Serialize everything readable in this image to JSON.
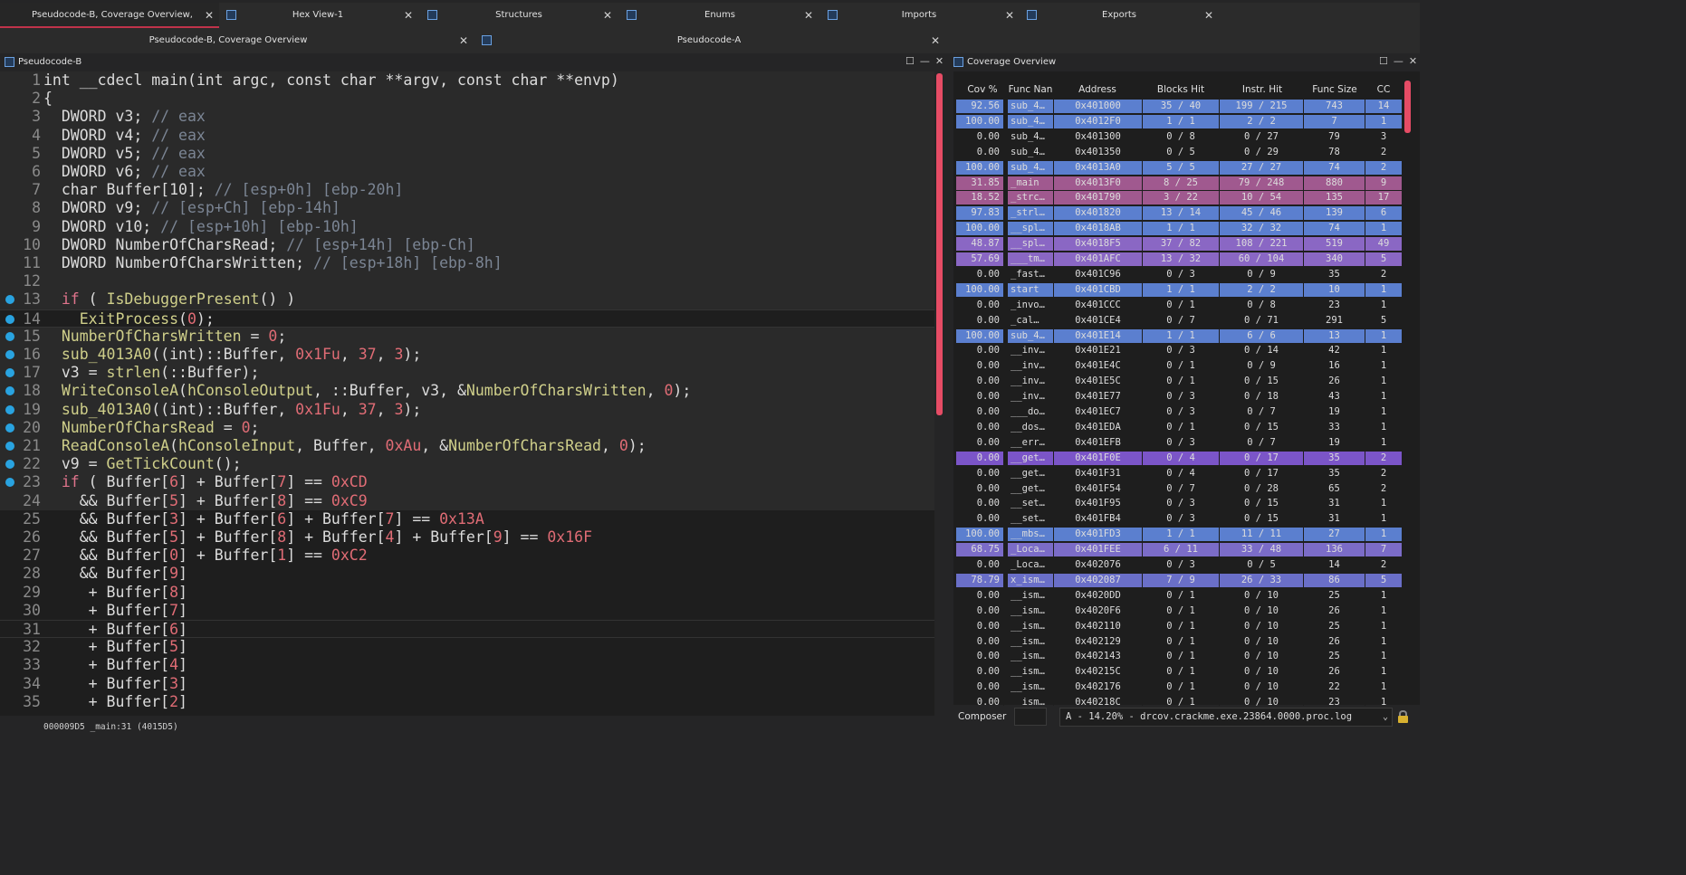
{
  "tabs_row1": [
    {
      "label": "Pseudocode-B, Coverage Overview, Pseudocode-A",
      "active": true
    },
    {
      "label": "Hex View-1",
      "active": false
    },
    {
      "label": "Structures",
      "active": false
    },
    {
      "label": "Enums",
      "active": false
    },
    {
      "label": "Imports",
      "active": false
    },
    {
      "label": "Exports",
      "active": false
    }
  ],
  "tabs_row2": [
    {
      "label": "Pseudocode-B, Coverage Overview"
    },
    {
      "label": "Pseudocode-A"
    }
  ],
  "close_glyph": "✕",
  "pseudocode_panel": {
    "title": "Pseudocode-B"
  },
  "coverage_panel": {
    "title": "Coverage Overview"
  },
  "code_lines": [
    {
      "n": "1",
      "bp": false,
      "hl": true,
      "html": "int __cdecl main(int argc, const char **argv, const char **envp)"
    },
    {
      "n": "2",
      "bp": false,
      "hl": true,
      "html": "{"
    },
    {
      "n": "3",
      "bp": false,
      "hl": true,
      "html": "  DWORD v3; <span class='cm'>// eax</span>"
    },
    {
      "n": "4",
      "bp": false,
      "hl": true,
      "html": "  DWORD v4; <span class='cm'>// eax</span>"
    },
    {
      "n": "5",
      "bp": false,
      "hl": true,
      "html": "  DWORD v5; <span class='cm'>// eax</span>"
    },
    {
      "n": "6",
      "bp": false,
      "hl": true,
      "html": "  DWORD v6; <span class='cm'>// eax</span>"
    },
    {
      "n": "7",
      "bp": false,
      "hl": true,
      "html": "  char Buffer[10]; <span class='cm'>// [esp+0h] [ebp-20h]</span>"
    },
    {
      "n": "8",
      "bp": false,
      "hl": true,
      "html": "  DWORD v9; <span class='cm'>// [esp+Ch] [ebp-14h]</span>"
    },
    {
      "n": "9",
      "bp": false,
      "hl": true,
      "html": "  DWORD v10; <span class='cm'>// [esp+10h] [ebp-10h]</span>"
    },
    {
      "n": "10",
      "bp": false,
      "hl": true,
      "html": "  DWORD NumberOfCharsRead; <span class='cm'>// [esp+14h] [ebp-Ch]</span>"
    },
    {
      "n": "11",
      "bp": false,
      "hl": true,
      "html": "  DWORD NumberOfCharsWritten; <span class='cm'>// [esp+18h] [ebp-8h]</span>"
    },
    {
      "n": "12",
      "bp": false,
      "hl": true,
      "html": ""
    },
    {
      "n": "13",
      "bp": true,
      "hl": true,
      "html": "  <span class='kw'>if</span> ( <span class='fn'>IsDebuggerPresent</span>() )"
    },
    {
      "n": "14",
      "bp": true,
      "hl": false,
      "cur": true,
      "html": "    <span class='fn'>ExitProcess</span>(<span class='num'>0</span>);"
    },
    {
      "n": "15",
      "bp": true,
      "hl": true,
      "html": "  <span class='fn'>NumberOfCharsWritten</span> = <span class='num'>0</span>;"
    },
    {
      "n": "16",
      "bp": true,
      "hl": true,
      "html": "  <span class='fn'>sub_4013A0</span>((int)::Buffer, <span class='num'>0x1Fu</span>, <span class='num'>37</span>, <span class='num'>3</span>);"
    },
    {
      "n": "17",
      "bp": true,
      "hl": true,
      "html": "  v3 = <span class='fn'>strlen</span>(::Buffer);"
    },
    {
      "n": "18",
      "bp": true,
      "hl": true,
      "html": "  <span class='fn'>WriteConsoleA</span>(<span class='fn'>hConsoleOutput</span>, ::Buffer, v3, &amp;<span class='fn'>NumberOfCharsWritten</span>, <span class='num'>0</span>);"
    },
    {
      "n": "19",
      "bp": true,
      "hl": true,
      "html": "  <span class='fn'>sub_4013A0</span>((int)::Buffer, <span class='num'>0x1Fu</span>, <span class='num'>37</span>, <span class='num'>3</span>);"
    },
    {
      "n": "20",
      "bp": true,
      "hl": true,
      "html": "  <span class='fn'>NumberOfCharsRead</span> = <span class='num'>0</span>;"
    },
    {
      "n": "21",
      "bp": true,
      "hl": true,
      "html": "  <span class='fn'>ReadConsoleA</span>(<span class='fn'>hConsoleInput</span>, Buffer, <span class='num'>0xAu</span>, &amp;<span class='fn'>NumberOfCharsRead</span>, <span class='num'>0</span>);"
    },
    {
      "n": "22",
      "bp": true,
      "hl": true,
      "html": "  v9 = <span class='fn'>GetTickCount</span>();"
    },
    {
      "n": "23",
      "bp": true,
      "hl": true,
      "html": "  <span class='kw'>if</span> ( Buffer[<span class='num'>6</span>] + Buffer[<span class='num'>7</span>] == <span class='num'>0xCD</span>"
    },
    {
      "n": "24",
      "bp": false,
      "hl": true,
      "html": "    &amp;&amp; Buffer[<span class='num'>5</span>] + Buffer[<span class='num'>8</span>] == <span class='num'>0xC9</span>"
    },
    {
      "n": "25",
      "bp": false,
      "hl": false,
      "html": "    &amp;&amp; Buffer[<span class='num'>3</span>] + Buffer[<span class='num'>6</span>] + Buffer[<span class='num'>7</span>] == <span class='num'>0x13A</span>"
    },
    {
      "n": "26",
      "bp": false,
      "hl": false,
      "html": "    &amp;&amp; Buffer[<span class='num'>5</span>] + Buffer[<span class='num'>8</span>] + Buffer[<span class='num'>4</span>] + Buffer[<span class='num'>9</span>] == <span class='num'>0x16F</span>"
    },
    {
      "n": "27",
      "bp": false,
      "hl": false,
      "html": "    &amp;&amp; Buffer[<span class='num'>0</span>] + Buffer[<span class='num'>1</span>] == <span class='num'>0xC2</span>"
    },
    {
      "n": "28",
      "bp": false,
      "hl": false,
      "html": "    &amp;&amp; Buffer[<span class='num'>9</span>]"
    },
    {
      "n": "29",
      "bp": false,
      "hl": false,
      "html": "     + Buffer[<span class='num'>8</span>]"
    },
    {
      "n": "30",
      "bp": false,
      "hl": false,
      "html": "     + Buffer[<span class='num'>7</span>]"
    },
    {
      "n": "31",
      "bp": false,
      "hl": false,
      "cur": true,
      "html": "     + Buffer[<span class='num'>6</span>]"
    },
    {
      "n": "32",
      "bp": false,
      "hl": false,
      "html": "     + Buffer[<span class='num'>5</span>]"
    },
    {
      "n": "33",
      "bp": false,
      "hl": false,
      "html": "     + Buffer[<span class='num'>4</span>]"
    },
    {
      "n": "34",
      "bp": false,
      "hl": false,
      "html": "     + Buffer[<span class='num'>3</span>]"
    },
    {
      "n": "35",
      "bp": false,
      "hl": false,
      "html": "     + Buffer[<span class='num'>2</span>]"
    }
  ],
  "status_line": "000009D5 _main:31 (4015D5)",
  "coverage": {
    "columns": [
      "Cov %",
      "Func Nan",
      "Address",
      "Blocks Hit",
      "Instr. Hit",
      "Func Size",
      "CC"
    ],
    "rows": [
      {
        "cov": "92.56",
        "name": "sub_4…",
        "addr": "0x401000",
        "blocks": "35 / 40",
        "instr": "199 / 215",
        "size": "743",
        "cc": "14",
        "bg": "#5b7fcf"
      },
      {
        "cov": "100.00",
        "name": "sub_4…",
        "addr": "0x4012F0",
        "blocks": "1 / 1",
        "instr": "2 / 2",
        "size": "7",
        "cc": "1",
        "bg": "#5b7fcf"
      },
      {
        "cov": "0.00",
        "name": "sub_4…",
        "addr": "0x401300",
        "blocks": "0 / 8",
        "instr": "0 / 27",
        "size": "79",
        "cc": "3",
        "bg": ""
      },
      {
        "cov": "0.00",
        "name": "sub_4…",
        "addr": "0x401350",
        "blocks": "0 / 5",
        "instr": "0 / 29",
        "size": "78",
        "cc": "2",
        "bg": ""
      },
      {
        "cov": "100.00",
        "name": "sub_4…",
        "addr": "0x4013A0",
        "blocks": "5 / 5",
        "instr": "27 / 27",
        "size": "74",
        "cc": "2",
        "bg": "#5b7fcf"
      },
      {
        "cov": "31.85",
        "name": "_main",
        "addr": "0x4013F0",
        "blocks": "8 / 25",
        "instr": "79 / 248",
        "size": "880",
        "cc": "9",
        "bg": "#a0598f"
      },
      {
        "cov": "18.52",
        "name": "_strc…",
        "addr": "0x401790",
        "blocks": "3 / 22",
        "instr": "10 / 54",
        "size": "135",
        "cc": "17",
        "bg": "#a0598f"
      },
      {
        "cov": "97.83",
        "name": "_strl…",
        "addr": "0x401820",
        "blocks": "13 / 14",
        "instr": "45 / 46",
        "size": "139",
        "cc": "6",
        "bg": "#5b7fcf"
      },
      {
        "cov": "100.00",
        "name": "__spl…",
        "addr": "0x4018AB",
        "blocks": "1 / 1",
        "instr": "32 / 32",
        "size": "74",
        "cc": "1",
        "bg": "#5b7fcf"
      },
      {
        "cov": "48.87",
        "name": "__spl…",
        "addr": "0x4018F5",
        "blocks": "37 / 82",
        "instr": "108 / 221",
        "size": "519",
        "cc": "49",
        "bg": "#8a67c4"
      },
      {
        "cov": "57.69",
        "name": "___tm…",
        "addr": "0x401AFC",
        "blocks": "13 / 32",
        "instr": "60 / 104",
        "size": "340",
        "cc": "5",
        "bg": "#8a67c4"
      },
      {
        "cov": "0.00",
        "name": "_fast…",
        "addr": "0x401C96",
        "blocks": "0 / 3",
        "instr": "0 / 9",
        "size": "35",
        "cc": "2",
        "bg": ""
      },
      {
        "cov": "100.00",
        "name": "start",
        "addr": "0x401CBD",
        "blocks": "1 / 1",
        "instr": "2 / 2",
        "size": "10",
        "cc": "1",
        "bg": "#5b7fcf"
      },
      {
        "cov": "0.00",
        "name": "_invo…",
        "addr": "0x401CCC",
        "blocks": "0 / 1",
        "instr": "0 / 8",
        "size": "23",
        "cc": "1",
        "bg": ""
      },
      {
        "cov": "0.00",
        "name": "_cal…",
        "addr": "0x401CE4",
        "blocks": "0 / 7",
        "instr": "0 / 71",
        "size": "291",
        "cc": "5",
        "bg": ""
      },
      {
        "cov": "100.00",
        "name": "sub_4…",
        "addr": "0x401E14",
        "blocks": "1 / 1",
        "instr": "6 / 6",
        "size": "13",
        "cc": "1",
        "bg": "#5b7fcf"
      },
      {
        "cov": "0.00",
        "name": "__inv…",
        "addr": "0x401E21",
        "blocks": "0 / 3",
        "instr": "0 / 14",
        "size": "42",
        "cc": "1",
        "bg": ""
      },
      {
        "cov": "0.00",
        "name": "__inv…",
        "addr": "0x401E4C",
        "blocks": "0 / 1",
        "instr": "0 / 9",
        "size": "16",
        "cc": "1",
        "bg": ""
      },
      {
        "cov": "0.00",
        "name": "__inv…",
        "addr": "0x401E5C",
        "blocks": "0 / 1",
        "instr": "0 / 15",
        "size": "26",
        "cc": "1",
        "bg": ""
      },
      {
        "cov": "0.00",
        "name": "__inv…",
        "addr": "0x401E77",
        "blocks": "0 / 3",
        "instr": "0 / 18",
        "size": "43",
        "cc": "1",
        "bg": ""
      },
      {
        "cov": "0.00",
        "name": "___do…",
        "addr": "0x401EC7",
        "blocks": "0 / 3",
        "instr": "0 / 7",
        "size": "19",
        "cc": "1",
        "bg": ""
      },
      {
        "cov": "0.00",
        "name": "__dos…",
        "addr": "0x401EDA",
        "blocks": "0 / 1",
        "instr": "0 / 15",
        "size": "33",
        "cc": "1",
        "bg": ""
      },
      {
        "cov": "0.00",
        "name": "__err…",
        "addr": "0x401EFB",
        "blocks": "0 / 3",
        "instr": "0 / 7",
        "size": "19",
        "cc": "1",
        "bg": ""
      },
      {
        "cov": "0.00",
        "name": "__get…",
        "addr": "0x401F0E",
        "blocks": "0 / 4",
        "instr": "0 / 17",
        "size": "35",
        "cc": "2",
        "bg": "#7b55c8"
      },
      {
        "cov": "0.00",
        "name": "__get…",
        "addr": "0x401F31",
        "blocks": "0 / 4",
        "instr": "0 / 17",
        "size": "35",
        "cc": "2",
        "bg": ""
      },
      {
        "cov": "0.00",
        "name": "__get…",
        "addr": "0x401F54",
        "blocks": "0 / 7",
        "instr": "0 / 28",
        "size": "65",
        "cc": "2",
        "bg": ""
      },
      {
        "cov": "0.00",
        "name": "__set…",
        "addr": "0x401F95",
        "blocks": "0 / 3",
        "instr": "0 / 15",
        "size": "31",
        "cc": "1",
        "bg": ""
      },
      {
        "cov": "0.00",
        "name": "__set…",
        "addr": "0x401FB4",
        "blocks": "0 / 3",
        "instr": "0 / 15",
        "size": "31",
        "cc": "1",
        "bg": ""
      },
      {
        "cov": "100.00",
        "name": "__mbs…",
        "addr": "0x401FD3",
        "blocks": "1 / 1",
        "instr": "11 / 11",
        "size": "27",
        "cc": "1",
        "bg": "#5b7fcf"
      },
      {
        "cov": "68.75",
        "name": "_Loca…",
        "addr": "0x401FEE",
        "blocks": "6 / 11",
        "instr": "33 / 48",
        "size": "136",
        "cc": "7",
        "bg": "#7b6cc8"
      },
      {
        "cov": "0.00",
        "name": "_Loca…",
        "addr": "0x402076",
        "blocks": "0 / 3",
        "instr": "0 / 5",
        "size": "14",
        "cc": "2",
        "bg": ""
      },
      {
        "cov": "78.79",
        "name": "x_ism…",
        "addr": "0x402087",
        "blocks": "7 / 9",
        "instr": "26 / 33",
        "size": "86",
        "cc": "5",
        "bg": "#6a6fc8"
      },
      {
        "cov": "0.00",
        "name": "__ism…",
        "addr": "0x4020DD",
        "blocks": "0 / 1",
        "instr": "0 / 10",
        "size": "25",
        "cc": "1",
        "bg": ""
      },
      {
        "cov": "0.00",
        "name": "__ism…",
        "addr": "0x4020F6",
        "blocks": "0 / 1",
        "instr": "0 / 10",
        "size": "26",
        "cc": "1",
        "bg": ""
      },
      {
        "cov": "0.00",
        "name": "__ism…",
        "addr": "0x402110",
        "blocks": "0 / 1",
        "instr": "0 / 10",
        "size": "25",
        "cc": "1",
        "bg": ""
      },
      {
        "cov": "0.00",
        "name": "__ism…",
        "addr": "0x402129",
        "blocks": "0 / 1",
        "instr": "0 / 10",
        "size": "26",
        "cc": "1",
        "bg": ""
      },
      {
        "cov": "0.00",
        "name": "__ism…",
        "addr": "0x402143",
        "blocks": "0 / 1",
        "instr": "0 / 10",
        "size": "25",
        "cc": "1",
        "bg": ""
      },
      {
        "cov": "0.00",
        "name": "__ism…",
        "addr": "0x40215C",
        "blocks": "0 / 1",
        "instr": "0 / 10",
        "size": "26",
        "cc": "1",
        "bg": ""
      },
      {
        "cov": "0.00",
        "name": "__ism…",
        "addr": "0x402176",
        "blocks": "0 / 1",
        "instr": "0 / 10",
        "size": "22",
        "cc": "1",
        "bg": ""
      },
      {
        "cov": "0.00",
        "name": "__ism…",
        "addr": "0x40218C",
        "blocks": "0 / 1",
        "instr": "0 / 10",
        "size": "23",
        "cc": "1",
        "bg": ""
      }
    ]
  },
  "composer": {
    "label": "Composer",
    "selected": "A - 14.20% - drcov.crackme.exe.23864.0000.proc.log",
    "chevron": "⌄"
  },
  "colors": {
    "accent": "#e64c65",
    "breakpoint": "#29a3e0"
  }
}
